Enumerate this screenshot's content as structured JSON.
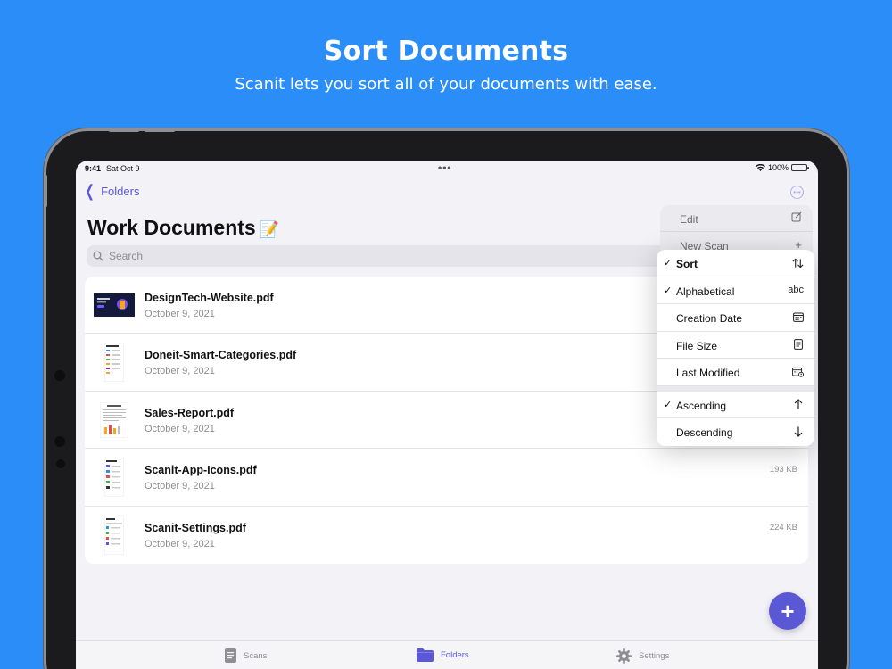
{
  "promo": {
    "title": "Sort Documents",
    "subtitle": "Scanit lets you sort all of your documents with ease."
  },
  "status_bar": {
    "time": "9:41",
    "date": "Sat Oct 9",
    "battery": "100%"
  },
  "nav": {
    "back_label": "Folders",
    "title": "Work Documents",
    "title_emoji": "📝"
  },
  "search": {
    "placeholder": "Search"
  },
  "documents": [
    {
      "name": "DesignTech-Website.pdf",
      "date": "October 9, 2021",
      "size": ""
    },
    {
      "name": "Doneit-Smart-Categories.pdf",
      "date": "October 9, 2021",
      "size": ""
    },
    {
      "name": "Sales-Report.pdf",
      "date": "October 9, 2021",
      "size": ""
    },
    {
      "name": "Scanit-App-Icons.pdf",
      "date": "October 9, 2021",
      "size": "193 KB"
    },
    {
      "name": "Scanit-Settings.pdf",
      "date": "October 9, 2021",
      "size": "224 KB"
    }
  ],
  "background_menu": {
    "edit": "Edit",
    "new_scan": "New Scan"
  },
  "sort_menu": {
    "header": "Sort",
    "fields": [
      {
        "label": "Alphabetical",
        "checked": true,
        "icon": "abc"
      },
      {
        "label": "Creation Date",
        "checked": false,
        "icon": "calendar-icon"
      },
      {
        "label": "File Size",
        "checked": false,
        "icon": "doc-icon"
      },
      {
        "label": "Last Modified",
        "checked": false,
        "icon": "calendar-clock-icon"
      }
    ],
    "order": [
      {
        "label": "Ascending",
        "checked": true,
        "icon": "arrow-up-icon"
      },
      {
        "label": "Descending",
        "checked": false,
        "icon": "arrow-down-icon"
      }
    ],
    "check_glyph": "✓"
  },
  "fab": {
    "label": "+"
  },
  "tabs": [
    {
      "label": "Scans",
      "active": false
    },
    {
      "label": "Folders",
      "active": true
    },
    {
      "label": "Settings",
      "active": false
    }
  ],
  "colors": {
    "background": "#2a8df8",
    "accent": "#5b58d6"
  }
}
